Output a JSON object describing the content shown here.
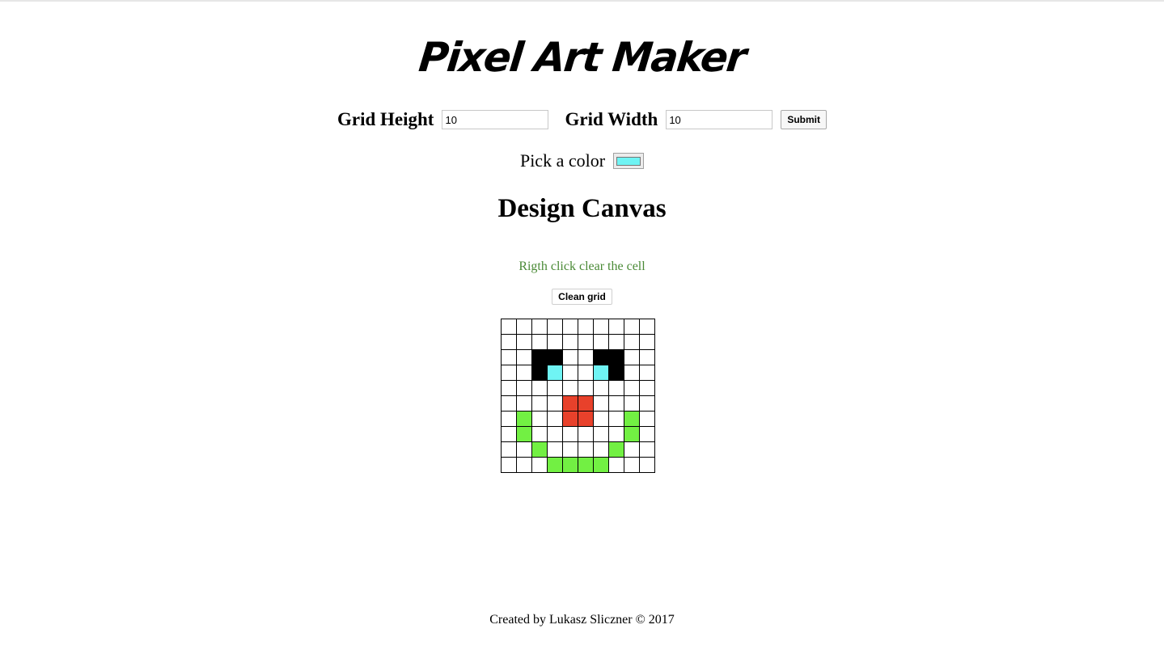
{
  "app": {
    "title": "Pixel Art Maker"
  },
  "size_form": {
    "height_label": "Grid Height",
    "height_value": "10",
    "width_label": "Grid Width",
    "width_value": "10",
    "submit_label": "Submit"
  },
  "color_picker": {
    "label": "Pick a color",
    "value": "#6ff4f4"
  },
  "canvas": {
    "heading": "Design Canvas",
    "hint": "Rigth click clear the cell",
    "clean_label": "Clean grid",
    "rows": 10,
    "cols": 10,
    "palette": {
      "W": "#ffffff",
      "K": "#000000",
      "C": "#6ff4f4",
      "R": "#e8412b",
      "G": "#72f043"
    },
    "pixels": [
      "WWWWWWWWWW",
      "WWWWWWWWWW",
      "WWKKWWKKWW",
      "WWKCWWCKWW",
      "WWWWWWWWWW",
      "WWWWRRWWWW",
      "WGWWRRWWGW",
      "WGWWWWWWGW",
      "WWGWWWWGWW",
      "WWWGGGGWWW"
    ]
  },
  "footer": {
    "text": "Created by Lukasz Sliczner © 2017"
  }
}
